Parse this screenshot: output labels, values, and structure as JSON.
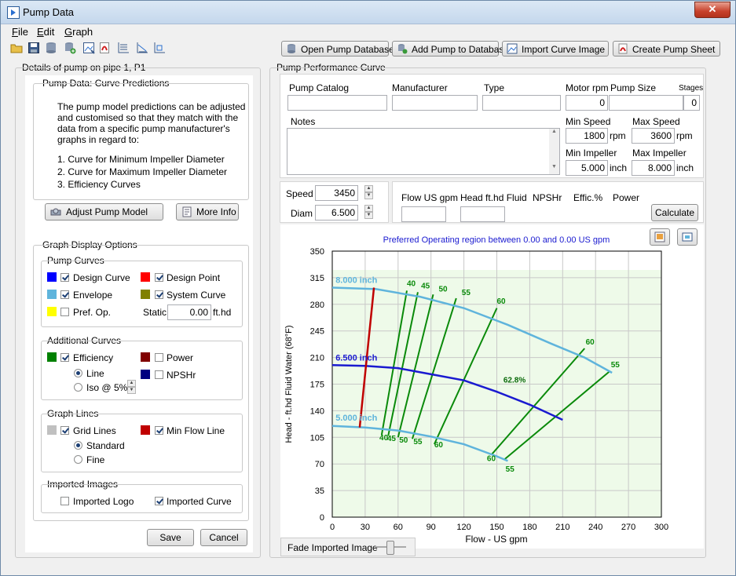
{
  "window": {
    "title": "Pump Data"
  },
  "menu": [
    {
      "label": "File",
      "key": "F",
      "rest": "ile"
    },
    {
      "label": "Edit",
      "key": "E",
      "rest": "dit"
    },
    {
      "label": "Graph",
      "key": "G",
      "rest": "raph"
    }
  ],
  "toolbar": {
    "open_db": "Open Pump Database",
    "add_pump": "Add Pump to Database",
    "import_curve": "Import Curve Image",
    "create_sheet": "Create Pump Sheet"
  },
  "left": {
    "title": "Details of pump on pipe 1, P1",
    "predictions": {
      "title": "Pump Data: Curve Predictions",
      "para": [
        "The pump model predictions can be adjusted",
        "and customised so that they match with the",
        "data from a specific pump manufacturer's",
        "graphs in regard to:"
      ],
      "list": [
        "1. Curve for Minimum Impeller Diameter",
        "2. Curve for Maximum Impeller Diameter",
        "3. Efficiency Curves"
      ],
      "adjust_btn": "Adjust Pump Model",
      "info_btn": "More Info"
    },
    "graph_options": {
      "title": "Graph Display Options",
      "pump_curves": {
        "title": "Pump Curves",
        "design_curve": "Design Curve",
        "design_point": "Design Point",
        "envelope": "Envelope",
        "system_curve": "System Curve",
        "pref_op": "Pref. Op.",
        "static_label": "Static",
        "static_value": "0.00",
        "static_unit": "ft.hd"
      },
      "additional": {
        "title": "Additional Curves",
        "efficiency": "Efficiency",
        "power": "Power",
        "line": "Line",
        "npshr": "NPSHr",
        "iso": "Iso @",
        "iso_value": "5%"
      },
      "graph_lines": {
        "title": "Graph Lines",
        "grid_lines": "Grid Lines",
        "min_flow": "Min Flow Line",
        "standard": "Standard",
        "fine": "Fine"
      },
      "imported": {
        "title": "Imported Images",
        "logo": "Imported Logo",
        "curve": "Imported Curve"
      }
    },
    "save_btn": "Save",
    "cancel_btn": "Cancel"
  },
  "colors": {
    "design_curve": "#0000ff",
    "design_point": "#ff0000",
    "envelope": "#5fb4dc",
    "system_curve": "#808000",
    "pref_op": "#ffff00",
    "efficiency": "#008000",
    "power": "#800000",
    "npshr": "#000080",
    "grid": "#c0c0c0",
    "min_flow": "#c00000"
  },
  "performance": {
    "title": "Pump Performance Curve",
    "catalog_label": "Pump Catalog",
    "catalog_value": "",
    "manufacturer_label": "Manufacturer",
    "manufacturer_value": "",
    "type_label": "Type",
    "type_value": "",
    "motor_rpm_label": "Motor rpm",
    "motor_rpm_value": "0",
    "pump_size_label": "Pump Size",
    "pump_size_value": "",
    "stages_label": "Stages",
    "stages_value": "0",
    "notes_label": "Notes",
    "min_speed_label": "Min Speed",
    "min_speed_value": "1800",
    "max_speed_label": "Max Speed",
    "max_speed_value": "3600",
    "rpm_unit": "rpm",
    "min_impeller_label": "Min Impeller",
    "min_impeller_value": "5.000",
    "max_impeller_label": "Max Impeller",
    "max_impeller_value": "8.000",
    "inch_unit": "inch",
    "speed_label": "Speed",
    "speed_value": "3450",
    "diam_label": "Diam",
    "diam_value": "6.500",
    "flow_label": "Flow US gpm",
    "head_label": "Head ft.hd Fluid",
    "npshr_label": "NPSHr",
    "effic_label": "Effic.%",
    "power_label": "Power",
    "calculate_btn": "Calculate",
    "fade_label": "Fade Imported Image"
  },
  "chart_data": {
    "type": "line",
    "title": "Preferred Operating region between 0.00 and 0.00 US gpm",
    "xlabel": "Flow - US gpm",
    "ylabel": "Head - ft.hd Fluid Water (68°F)",
    "xlim": [
      0,
      300
    ],
    "ylim": [
      0,
      350
    ],
    "xticks": [
      0,
      30,
      60,
      90,
      120,
      150,
      180,
      210,
      240,
      270,
      300
    ],
    "yticks": [
      0,
      35,
      70,
      105,
      140,
      175,
      210,
      245,
      280,
      315,
      350
    ],
    "grid": true,
    "series": [
      {
        "name": "8.000 inch",
        "color": "#5fb4dc",
        "x": [
          0,
          40,
          80,
          120,
          160,
          200,
          230,
          255
        ],
        "y": [
          302,
          300,
          290,
          275,
          253,
          228,
          210,
          190
        ]
      },
      {
        "name": "6.500 inch",
        "color": "#1a1ad0",
        "x": [
          0,
          30,
          60,
          90,
          120,
          150,
          180,
          210
        ],
        "y": [
          200,
          199,
          196,
          188,
          180,
          165,
          148,
          128
        ]
      },
      {
        "name": "5.000 inch",
        "color": "#5fb4dc",
        "x": [
          0,
          30,
          60,
          90,
          120,
          150,
          160
        ],
        "y": [
          120,
          118,
          114,
          106,
          96,
          80,
          74
        ]
      },
      {
        "name": "",
        "color": "#c00000",
        "x": [
          25,
          38
        ],
        "y": [
          118,
          302
        ]
      }
    ],
    "efficiency_lines": [
      {
        "label": "40",
        "x": [
          45,
          68
        ],
        "y": [
          108,
          298
        ]
      },
      {
        "label": "45",
        "x": [
          51,
          78
        ],
        "y": [
          107,
          296
        ]
      },
      {
        "label": "50",
        "x": [
          60,
          92
        ],
        "y": [
          105,
          293
        ]
      },
      {
        "label": "55",
        "x": [
          73,
          113
        ],
        "y": [
          103,
          288
        ]
      },
      {
        "label": "60",
        "x": [
          93,
          150
        ],
        "y": [
          96,
          275
        ]
      },
      {
        "label": "60",
        "x": [
          145,
          230
        ],
        "y": [
          82,
          222
        ]
      },
      {
        "label": "55",
        "x": [
          157,
          253
        ],
        "y": [
          76,
          192
        ]
      }
    ],
    "annotations": [
      {
        "text": "8.000 inch",
        "x": 3,
        "y": 308
      },
      {
        "text": "6.500 inch",
        "x": 3,
        "y": 206
      },
      {
        "text": "5.000 inch",
        "x": 3,
        "y": 127
      },
      {
        "text": "62.8%",
        "x": 156,
        "y": 177
      },
      {
        "text": "40",
        "x": 68,
        "y": 304
      },
      {
        "text": "45",
        "x": 81,
        "y": 301
      },
      {
        "text": "50",
        "x": 97,
        "y": 297
      },
      {
        "text": "55",
        "x": 118,
        "y": 292
      },
      {
        "text": "60",
        "x": 150,
        "y": 281
      },
      {
        "text": "60",
        "x": 231,
        "y": 227
      },
      {
        "text": "55",
        "x": 254,
        "y": 197
      },
      {
        "text": "40",
        "x": 43,
        "y": 101
      },
      {
        "text": "45",
        "x": 50,
        "y": 100
      },
      {
        "text": "50",
        "x": 61,
        "y": 98
      },
      {
        "text": "55",
        "x": 74,
        "y": 96
      },
      {
        "text": "60",
        "x": 93,
        "y": 92
      },
      {
        "text": "60",
        "x": 141,
        "y": 74
      },
      {
        "text": "55",
        "x": 158,
        "y": 60
      }
    ]
  }
}
